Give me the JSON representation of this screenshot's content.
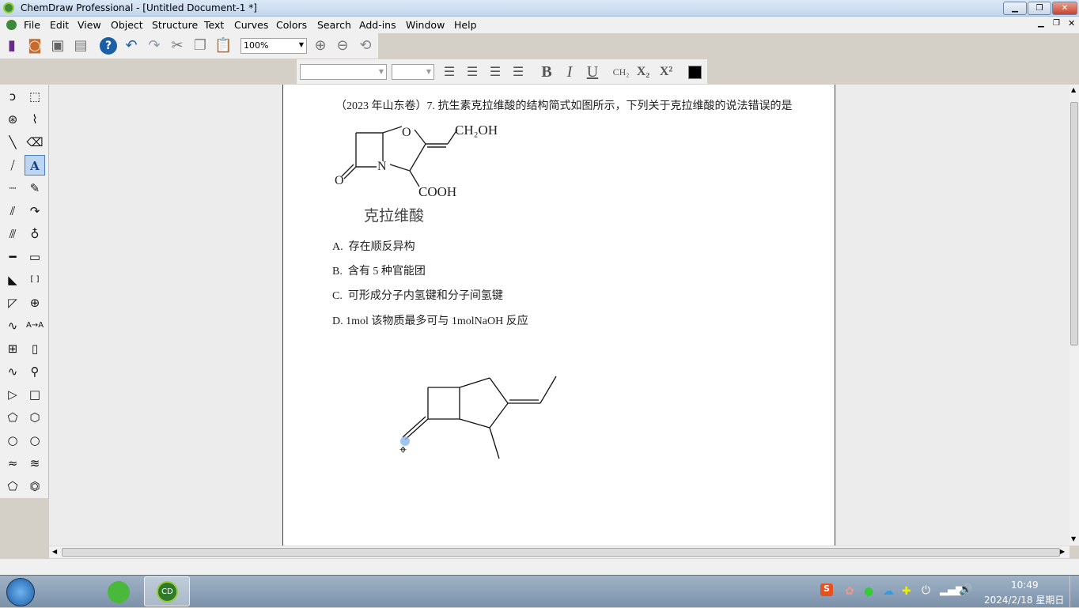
{
  "window": {
    "title": "ChemDraw Professional - [Untitled Document-1 *]",
    "minimize": "▁",
    "restore": "❐",
    "close": "✕"
  },
  "menu": [
    "File",
    "Edit",
    "View",
    "Object",
    "Structure",
    "Text",
    "Curves",
    "Colors",
    "Search",
    "Add-ins",
    "Window",
    "Help"
  ],
  "toolbar": {
    "zoom_value": "100%",
    "icons": [
      "new-document-icon",
      "open-icon",
      "save-icon",
      "print-icon",
      "help-icon",
      "undo-icon",
      "redo-icon",
      "cut-icon",
      "copy-icon",
      "paste-icon",
      "zoom-in-icon",
      "zoom-out-icon",
      "rotate-3d-icon"
    ]
  },
  "format_toolbar": {
    "bold": "B",
    "italic": "I",
    "underline": "U",
    "ch2": "CH₂",
    "subscript": "X₂",
    "superscript": "X²",
    "color": "#000000"
  },
  "palette": [
    "lasso",
    "marquee",
    "structure-perspective",
    "chain",
    "solid-bond",
    "eraser",
    "wedge-bond",
    "text",
    "dashed-bond",
    "pen",
    "hash-bond",
    "arrow",
    "bold-hash-bond",
    "mass-fragment",
    "bold-bond",
    "rectangle",
    "wedge",
    "bracket",
    "hollow-wedge",
    "charge",
    "wavy-bond",
    "acyclic-chain",
    "table",
    "tlc",
    "orbital",
    "template",
    "triangle",
    "square",
    "pentagon",
    "hexagon",
    "cyclohexane",
    "cyclopropane",
    "cyclohexane-chair1",
    "cyclohexane-chair2",
    "cyclopentane",
    "benzene"
  ],
  "document": {
    "question": "（2023 年山东卷）7. 抗生素克拉维酸的结构简式如图所示，下列关于克拉维酸的说法错误的是",
    "molecule": {
      "name": "克拉维酸",
      "o_ring": "O",
      "n": "N",
      "o_carbonyl": "O",
      "ch2oh": "CH₂OH",
      "cooh": "COOH"
    },
    "options": [
      "A.  存在顺反异构",
      "B.  含有 5 种官能团",
      "C.  可形成分子内氢键和分子间氢键",
      "D. 1mol 该物质最多可与 1molNaOH 反应"
    ]
  },
  "taskbar": {
    "time": "10:49",
    "date": "2024/2/18 星期日"
  }
}
